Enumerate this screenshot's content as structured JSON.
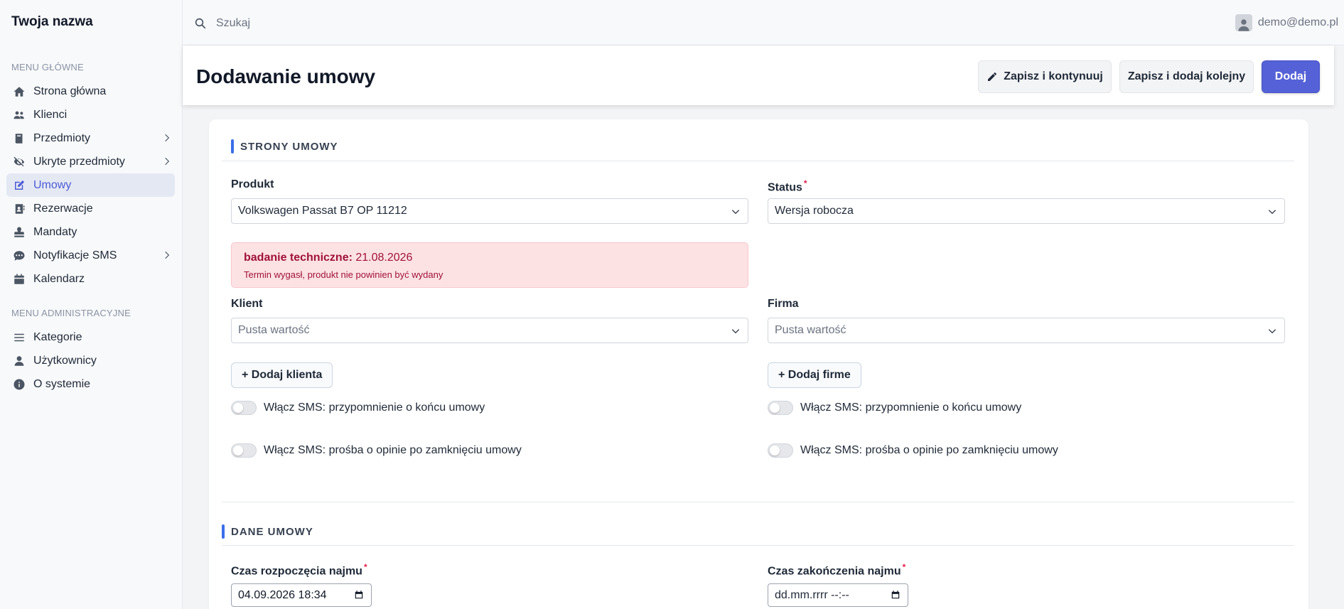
{
  "app": {
    "brand": "Twoja nazwa"
  },
  "sidebar": {
    "main_title": "MENU GŁÓWNE",
    "items": [
      {
        "label": "Strona główna",
        "icon": "home-icon"
      },
      {
        "label": "Klienci",
        "icon": "users-icon"
      },
      {
        "label": "Przedmioty",
        "icon": "book-icon",
        "expandable": true
      },
      {
        "label": "Ukryte przedmioty",
        "icon": "eye-slash-icon",
        "expandable": true
      },
      {
        "label": "Umowy",
        "icon": "edit-icon",
        "active": true
      },
      {
        "label": "Rezerwacje",
        "icon": "address-book-icon"
      },
      {
        "label": "Mandaty",
        "icon": "stamp-icon"
      },
      {
        "label": "Notyfikacje SMS",
        "icon": "sms-icon",
        "expandable": true
      },
      {
        "label": "Kalendarz",
        "icon": "calendar-icon"
      }
    ],
    "admin_title": "MENU ADMINISTRACYJNE",
    "admin_items": [
      {
        "label": "Kategorie",
        "icon": "list-icon"
      },
      {
        "label": "Użytkownicy",
        "icon": "user-icon"
      },
      {
        "label": "O systemie",
        "icon": "info-icon"
      }
    ]
  },
  "topbar": {
    "search_placeholder": "Szukaj",
    "user_email": "demo@demo.pl"
  },
  "header": {
    "title": "Dodawanie umowy",
    "save_continue_label": "Zapisz i kontynuuj",
    "save_add_next_label": "Zapisz i dodaj kolejny",
    "add_label": "Dodaj"
  },
  "form": {
    "section1_title": "STRONY UMOWY",
    "product_label": "Produkt",
    "product_value": "Volkswagen Passat B7 OP 11212",
    "status_label": "Status",
    "status_value": "Wersja robocza",
    "alert_title_bold": "badanie techniczne:",
    "alert_date": "21.08.2026",
    "alert_text": "Termin wygasł, produkt nie powinien być wydany",
    "client_label": "Klient",
    "client_placeholder": "Pusta wartość",
    "company_label": "Firma",
    "company_placeholder": "Pusta wartość",
    "add_client_label": "+ Dodaj klienta",
    "add_company_label": "+ Dodaj firme",
    "sms_end_reminder": "Włącz SMS: przypomnienie o końcu umowy",
    "sms_opinion_request": "Włącz SMS: prośba o opinie po zamknięciu umowy",
    "section2_title": "DANE UMOWY",
    "start_label": "Czas rozpoczęcia najmu",
    "start_value": "04.09.2026 18:34",
    "end_label": "Czas zakończenia najmu",
    "end_placeholder": "dd.mm.rrrr --:--"
  },
  "colors": {
    "accent": "#5561d6",
    "section_bar": "#3b6ee8",
    "alert_bg": "#fde2e4",
    "alert_text": "#9f1239",
    "required": "#e11d48"
  }
}
